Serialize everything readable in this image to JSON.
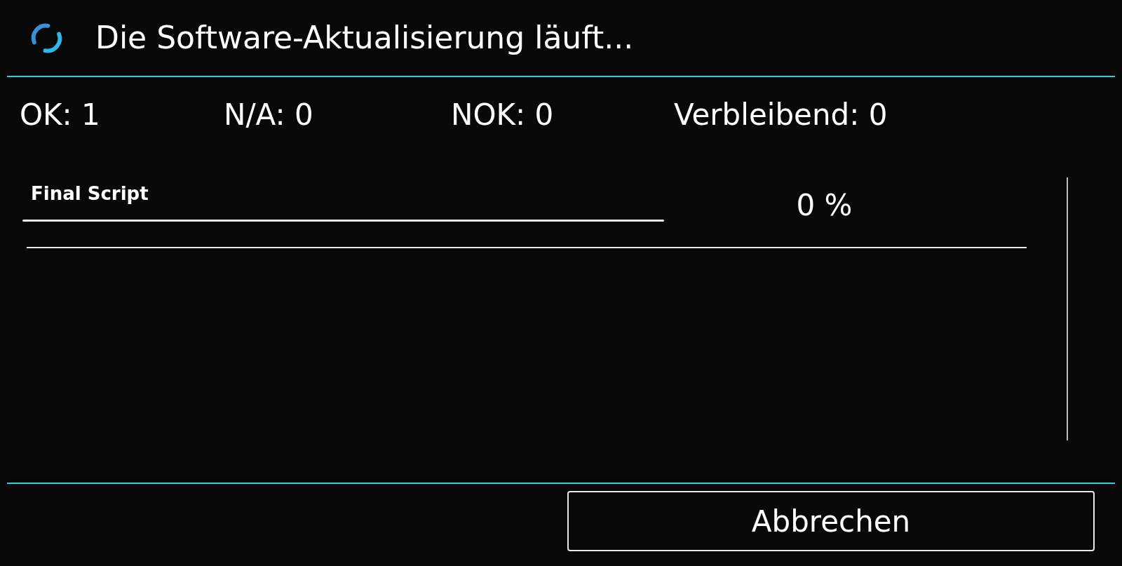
{
  "header": {
    "title": "Die Software-Aktualisierung läuft..."
  },
  "stats": [
    {
      "label": "OK: 1"
    },
    {
      "label": "N/A: 0"
    },
    {
      "label": "NOK: 0"
    },
    {
      "label": "Verbleibend: 0"
    }
  ],
  "current_item": {
    "name": "Final Script",
    "percent": "0 %"
  },
  "buttons": [
    {
      "label": "Abbrechen"
    }
  ]
}
